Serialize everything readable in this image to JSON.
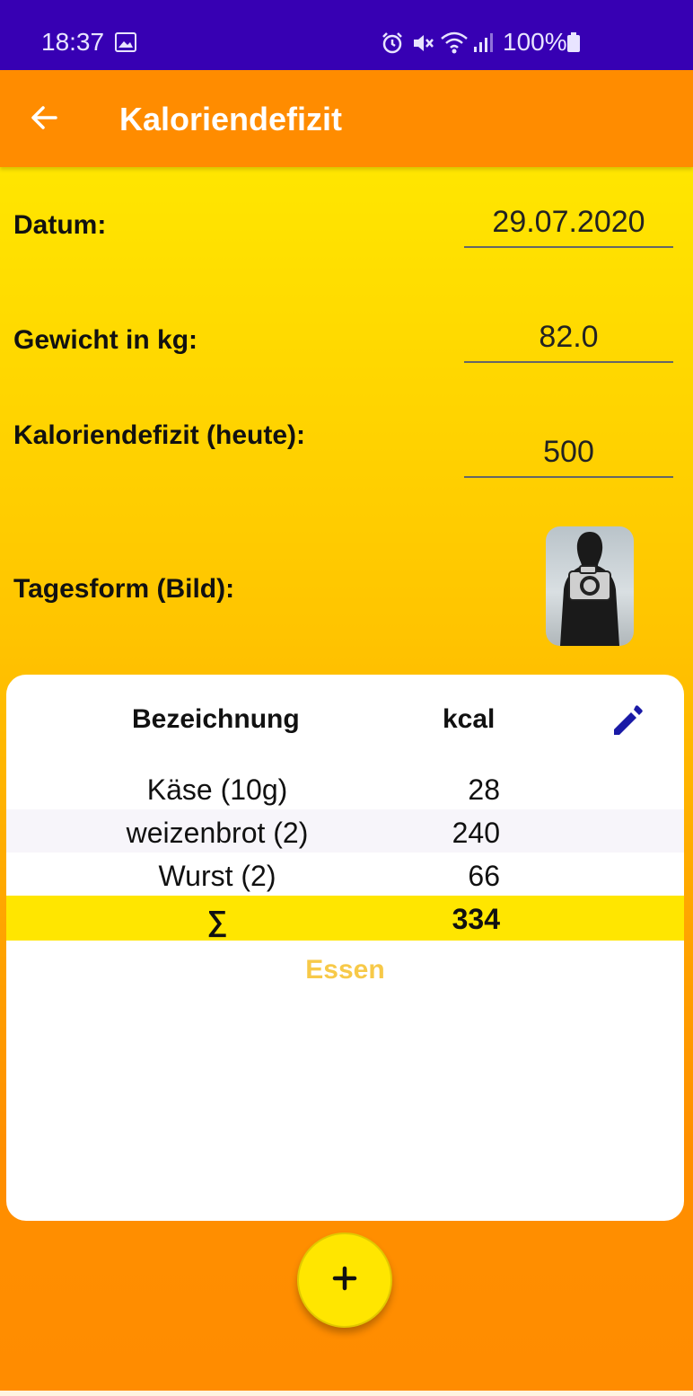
{
  "status": {
    "time": "18:37",
    "battery": "100%"
  },
  "appbar": {
    "title": "Kaloriendefizit"
  },
  "form": {
    "datum_label": "Datum:",
    "datum_value": "29.07.2020",
    "gewicht_label": "Gewicht in kg:",
    "gewicht_value": "82.0",
    "defizit_label": "Kaloriendefizit (heute):",
    "defizit_value": "500",
    "tagesform_label": "Tagesform (Bild):"
  },
  "table": {
    "col_name": "Bezeichnung",
    "col_kcal": "kcal",
    "rows": [
      {
        "name": "Käse (10g)",
        "kcal": "28"
      },
      {
        "name": "weizenbrot (2)",
        "kcal": "240"
      },
      {
        "name": "Wurst (2)",
        "kcal": "66"
      }
    ],
    "sum_symbol": "∑",
    "sum_value": "334",
    "footer_label": "Essen"
  },
  "fab": {
    "label": "+"
  },
  "colors": {
    "statusbar": "#3700b3",
    "appbar": "#ff8c00",
    "accent_yellow": "#ffe600",
    "edit_icon": "#1a1aa6",
    "essen_text": "#f7c948"
  },
  "icons": [
    "image-icon",
    "alarm-icon",
    "mute-icon",
    "wifi-icon",
    "signal-icon",
    "battery-icon",
    "back-arrow-icon",
    "camera-icon",
    "pencil-icon",
    "plus-icon"
  ]
}
